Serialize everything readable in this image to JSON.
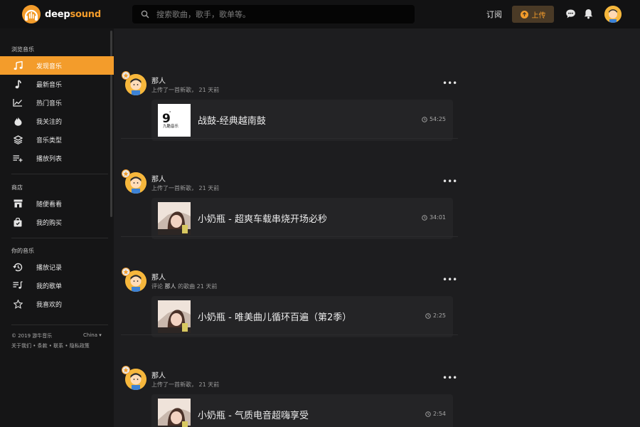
{
  "brand": {
    "name_plain": "deep",
    "name_accent": "sound"
  },
  "search": {
    "placeholder": "搜索歌曲，歌手，歌单等。"
  },
  "topbar": {
    "subscribe_label": "订阅",
    "upload_label": "上传"
  },
  "sidebar": {
    "sections": [
      {
        "title": "浏览音乐"
      },
      {
        "title": "商店"
      },
      {
        "title": "你的音乐"
      }
    ],
    "items": [
      {
        "label": "发现音乐",
        "icon": "music-note-icon",
        "active": true
      },
      {
        "label": "最新音乐",
        "icon": "single-note-icon"
      },
      {
        "label": "热门音乐",
        "icon": "trending-chart-icon"
      },
      {
        "label": "我关注的",
        "icon": "fire-drop-icon"
      },
      {
        "label": "音乐类型",
        "icon": "layers-icon"
      },
      {
        "label": "播放列表",
        "icon": "playlist-add-icon"
      },
      {
        "label": "随便看看",
        "icon": "store-icon"
      },
      {
        "label": "我的购买",
        "icon": "shopping-bag-icon"
      },
      {
        "label": "播放记录",
        "icon": "history-icon"
      },
      {
        "label": "我的歌单",
        "icon": "queue-music-icon"
      },
      {
        "label": "我喜欢的",
        "icon": "star-icon"
      }
    ],
    "footer": {
      "copyright": "© 2019 游牛音乐",
      "region": "China",
      "links": "关于我们 • 条款 • 联系 • 隐私政策"
    }
  },
  "feed": {
    "posts": [
      {
        "user": "那人",
        "action": "上传了一首新歌，",
        "ago": "21 天前",
        "track_title": "战鼓-经典越南鼓",
        "duration": "54:25",
        "cover": "logo-9",
        "cover_text": "九酷音乐"
      },
      {
        "user": "那人",
        "action": "上传了一首新歌，",
        "ago": "21 天前",
        "track_title": "小奶瓶 - 超爽车载串烧开场必秒",
        "duration": "34:01",
        "cover": "photo"
      },
      {
        "user": "那人",
        "action": "评论",
        "target_user": "那人",
        "target_suffix": "的歌曲",
        "ago": "21 天前",
        "track_title": "小奶瓶 - 唯美曲儿循环百遍（第2季）",
        "duration": "2:25",
        "cover": "photo"
      },
      {
        "user": "那人",
        "action": "上传了一首新歌，",
        "ago": "21 天前",
        "track_title": "小奶瓶 - 气质电音超嗨享受",
        "duration": "2:54",
        "cover": "photo"
      }
    ]
  },
  "colors": {
    "accent": "#f39c2b",
    "topbar": "#121213",
    "sidebar": "#151516",
    "background": "#1d1d1f",
    "card": "#242426"
  }
}
